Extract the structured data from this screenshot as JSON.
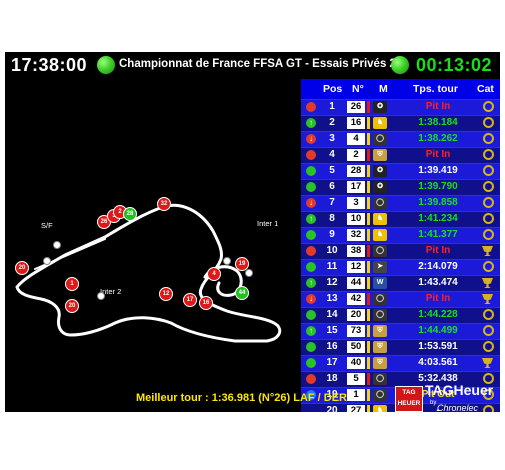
{
  "header": {
    "clock": "17:38:00",
    "title": "Championnat de France FFSA GT - Essais Privés 2",
    "session_timer": "00:13:02"
  },
  "table": {
    "columns": {
      "pos": "Pos",
      "num": "N°",
      "make": "M",
      "lap": "Tps. tour",
      "cat": "Cat"
    },
    "rows": [
      {
        "pos": "1",
        "num": "26",
        "make": "mercedes-logo",
        "bar": "red",
        "lap": "Pit In",
        "lap_color": "red",
        "status": "pit",
        "cat": "ring"
      },
      {
        "pos": "2",
        "num": "16",
        "make": "ferrari-logo",
        "bar": "yellow",
        "lap": "1:38.184",
        "lap_color": "green",
        "status": "up",
        "cat": "ring"
      },
      {
        "pos": "3",
        "num": "4",
        "make": "audi-logo",
        "bar": "yellow",
        "lap": "1:38.262",
        "lap_color": "green",
        "status": "down",
        "cat": "ring"
      },
      {
        "pos": "4",
        "num": "2",
        "make": "porsche-logo",
        "bar": "red",
        "lap": "Pit In",
        "lap_color": "red",
        "status": "pit",
        "cat": "ring"
      },
      {
        "pos": "5",
        "num": "28",
        "make": "mercedes-logo",
        "bar": "yellow",
        "lap": "1:39.419",
        "lap_color": "white",
        "status": "green",
        "cat": "ring"
      },
      {
        "pos": "6",
        "num": "17",
        "make": "mercedes-logo",
        "bar": "yellow",
        "lap": "1:39.790",
        "lap_color": "green",
        "status": "green",
        "cat": "ring"
      },
      {
        "pos": "7",
        "num": "3",
        "make": "audi-logo",
        "bar": "yellow",
        "lap": "1:39.858",
        "lap_color": "green",
        "status": "down",
        "cat": "ring"
      },
      {
        "pos": "8",
        "num": "10",
        "make": "ferrari-logo",
        "bar": "yellow",
        "lap": "1:41.234",
        "lap_color": "green",
        "status": "up",
        "cat": "ring"
      },
      {
        "pos": "9",
        "num": "32",
        "make": "ferrari-logo",
        "bar": "yellow",
        "lap": "1:41.377",
        "lap_color": "green",
        "status": "green",
        "cat": "ring"
      },
      {
        "pos": "10",
        "num": "38",
        "make": "audi-logo",
        "bar": "red",
        "lap": "Pit In",
        "lap_color": "red",
        "status": "pit",
        "cat": "cup"
      },
      {
        "pos": "11",
        "num": "12",
        "make": "mclaren-logo",
        "bar": "yellow",
        "lap": "2:14.079",
        "lap_color": "white",
        "status": "green",
        "cat": "ring"
      },
      {
        "pos": "12",
        "num": "44",
        "make": "vw-logo",
        "bar": "yellow",
        "lap": "1:43.474",
        "lap_color": "white",
        "status": "up",
        "cat": "cup"
      },
      {
        "pos": "13",
        "num": "42",
        "make": "audi-logo",
        "bar": "red",
        "lap": "Pit In",
        "lap_color": "red",
        "status": "down",
        "cat": "cup"
      },
      {
        "pos": "14",
        "num": "20",
        "make": "audi-logo",
        "bar": "yellow",
        "lap": "1:44.228",
        "lap_color": "green",
        "status": "green",
        "cat": "ring"
      },
      {
        "pos": "15",
        "num": "73",
        "make": "porsche-logo",
        "bar": "yellow",
        "lap": "1:44.499",
        "lap_color": "green",
        "status": "up",
        "cat": "ring"
      },
      {
        "pos": "16",
        "num": "50",
        "make": "porsche-logo",
        "bar": "yellow",
        "lap": "1:53.591",
        "lap_color": "white",
        "status": "green",
        "cat": "ring"
      },
      {
        "pos": "17",
        "num": "40",
        "make": "porsche-logo",
        "bar": "yellow",
        "lap": "4:03.561",
        "lap_color": "white",
        "status": "green",
        "cat": "cup"
      },
      {
        "pos": "18",
        "num": "5",
        "make": "audi-logo",
        "bar": "red",
        "lap": "5:32.438",
        "lap_color": "white",
        "status": "pit",
        "cat": "ring"
      },
      {
        "pos": "19",
        "num": "1",
        "make": "audi-logo",
        "bar": "yellow",
        "lap": "Pit Out",
        "lap_color": "yellow",
        "status": "blue",
        "cat": "ring"
      },
      {
        "pos": "20",
        "num": "27",
        "make": "ferrari-logo",
        "bar": "yellow",
        "lap": "-",
        "lap_color": "white",
        "status": "none",
        "cat": "ring"
      }
    ]
  },
  "track": {
    "labels": {
      "sf": "S/F",
      "inter1": "Inter 1",
      "inter2": "Inter 2"
    },
    "car_markers": [
      "20",
      "1",
      "20",
      "26",
      "32",
      "19",
      "44",
      "12",
      "17",
      "16",
      "4",
      "3",
      "2",
      "28"
    ]
  },
  "footer": {
    "best_lap": "Meilleur tour : 1:36.981 (N°26) LAF / DER",
    "logo_main": "TAGHeuer",
    "logo_by": "by",
    "logo_sub": "Chronelec"
  },
  "colors": {
    "flag_green": "#2ec81f",
    "table_header": "#0000e8",
    "row_light": "#1a1ad8",
    "row_dark": "#10108c",
    "lap_green": "#18e018",
    "pit_red": "#ff2020",
    "pit_out_yellow": "#ffe600",
    "best_lap_yellow": "#ffe600"
  }
}
